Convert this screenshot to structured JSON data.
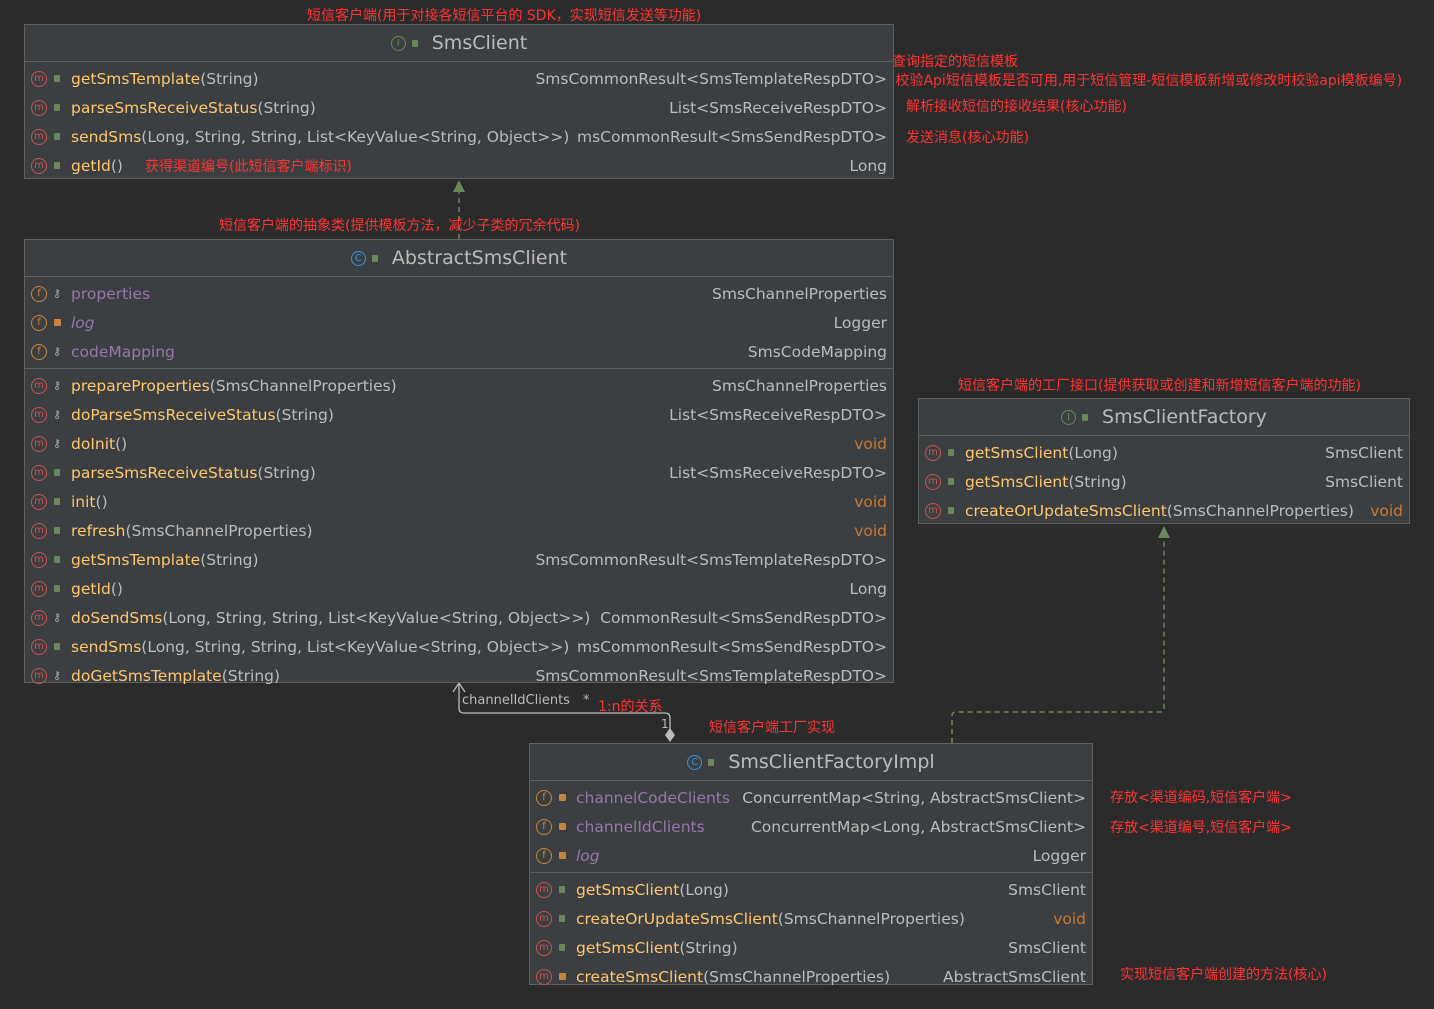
{
  "notes": {
    "sms_client_top": "短信客户端(用于对接各短信平台的 SDK，实现短信发送等功能)",
    "get_template_1": "查询指定的短信模板",
    "get_template_2": "(校验Api短信模板是否可用,用于短信管理-短信模板新增或修改时校验api模板编号)",
    "parse_receive": "解析接收短信的接收结果(核心功能)",
    "send": "发送消息(核心功能)",
    "get_id": "获得渠道编号(此短信客户端标识)",
    "abstract": "短信客户端的抽象类(提供模板方法，减少子类的冗余代码)",
    "factory": "短信客户端的工厂接口(提供获取或创建和新增短信客户端的功能)",
    "one_to_n": "1:n的关系",
    "factory_impl": "短信客户端工厂实现",
    "channel_code_clients": "存放<渠道编码,短信客户端>",
    "channel_id_clients": "存放<渠道编号,短信客户端>",
    "create_sms_client": "实现短信客户端创建的方法(核心)"
  },
  "assoc": {
    "role": "channelIdClients",
    "many": "*",
    "one": "1"
  },
  "sms_client": {
    "title": "SmsClient",
    "icon": "I",
    "methods": [
      {
        "name": "getSmsTemplate",
        "params": "(String)",
        "type": "SmsCommonResult<SmsTemplateRespDTO>"
      },
      {
        "name": "parseSmsReceiveStatus",
        "params": "(String)",
        "type": "List<SmsReceiveRespDTO>"
      },
      {
        "name": "sendSms",
        "params": "(Long, String, String, List<KeyValue<String, Object>>)",
        "type": "msCommonResult<SmsSendRespDTO>"
      },
      {
        "name": "getId",
        "params": " ()",
        "type": "Long"
      }
    ]
  },
  "abstract_client": {
    "title": "AbstractSmsClient",
    "icon": "C",
    "fields": [
      {
        "name": "properties",
        "type": "SmsChannelProperties"
      },
      {
        "name": "log",
        "type": "Logger"
      },
      {
        "name": "codeMapping",
        "type": "SmsCodeMapping"
      }
    ],
    "methods": [
      {
        "name": "prepareProperties",
        "params": "(SmsChannelProperties)",
        "type": "SmsChannelProperties"
      },
      {
        "name": "doParseSmsReceiveStatus",
        "params": "(String)",
        "type": "List<SmsReceiveRespDTO>"
      },
      {
        "name": "doInit",
        "params": "()",
        "type": "void"
      },
      {
        "name": "parseSmsReceiveStatus",
        "params": "(String)",
        "type": "List<SmsReceiveRespDTO>"
      },
      {
        "name": "init",
        "params": "()",
        "type": "void"
      },
      {
        "name": "refresh",
        "params": "(SmsChannelProperties)",
        "type": "void"
      },
      {
        "name": "getSmsTemplate",
        "params": "(String)",
        "type": "SmsCommonResult<SmsTemplateRespDTO>"
      },
      {
        "name": "getId",
        "params": " ()",
        "type": "Long"
      },
      {
        "name": "doSendSms",
        "params": "(Long, String, String, List<KeyValue<String, Object>>)",
        "type": "CommonResult<SmsSendRespDTO>"
      },
      {
        "name": "sendSms",
        "params": "(Long, String, String, List<KeyValue<String, Object>>)",
        "type": "msCommonResult<SmsSendRespDTO>"
      },
      {
        "name": "doGetSmsTemplate",
        "params": "(String)",
        "type": "SmsCommonResult<SmsTemplateRespDTO>"
      }
    ]
  },
  "factory": {
    "title": "SmsClientFactory",
    "icon": "I",
    "methods": [
      {
        "name": "getSmsClient",
        "params": "(Long)",
        "type": "SmsClient"
      },
      {
        "name": "getSmsClient",
        "params": "(String)",
        "type": "SmsClient"
      },
      {
        "name": "createOrUpdateSmsClient",
        "params": "(SmsChannelProperties)",
        "type": "void"
      }
    ]
  },
  "factory_impl": {
    "title": "SmsClientFactoryImpl",
    "icon": "C",
    "fields": [
      {
        "name": "channelCodeClients",
        "type": "ConcurrentMap<String, AbstractSmsClient>"
      },
      {
        "name": "channelIdClients",
        "type": "ConcurrentMap<Long, AbstractSmsClient>"
      },
      {
        "name": "log",
        "type": "Logger"
      }
    ],
    "methods": [
      {
        "name": "getSmsClient",
        "params": "(Long)",
        "type": "SmsClient"
      },
      {
        "name": "createOrUpdateSmsClient",
        "params": "(SmsChannelProperties)",
        "type": "void"
      },
      {
        "name": "getSmsClient",
        "params": "(String)",
        "type": "SmsClient"
      },
      {
        "name": "createSmsClient",
        "params": "(SmsChannelProperties)",
        "type": "AbstractSmsClient"
      }
    ]
  },
  "icons": {
    "method": "m",
    "field": "f"
  }
}
